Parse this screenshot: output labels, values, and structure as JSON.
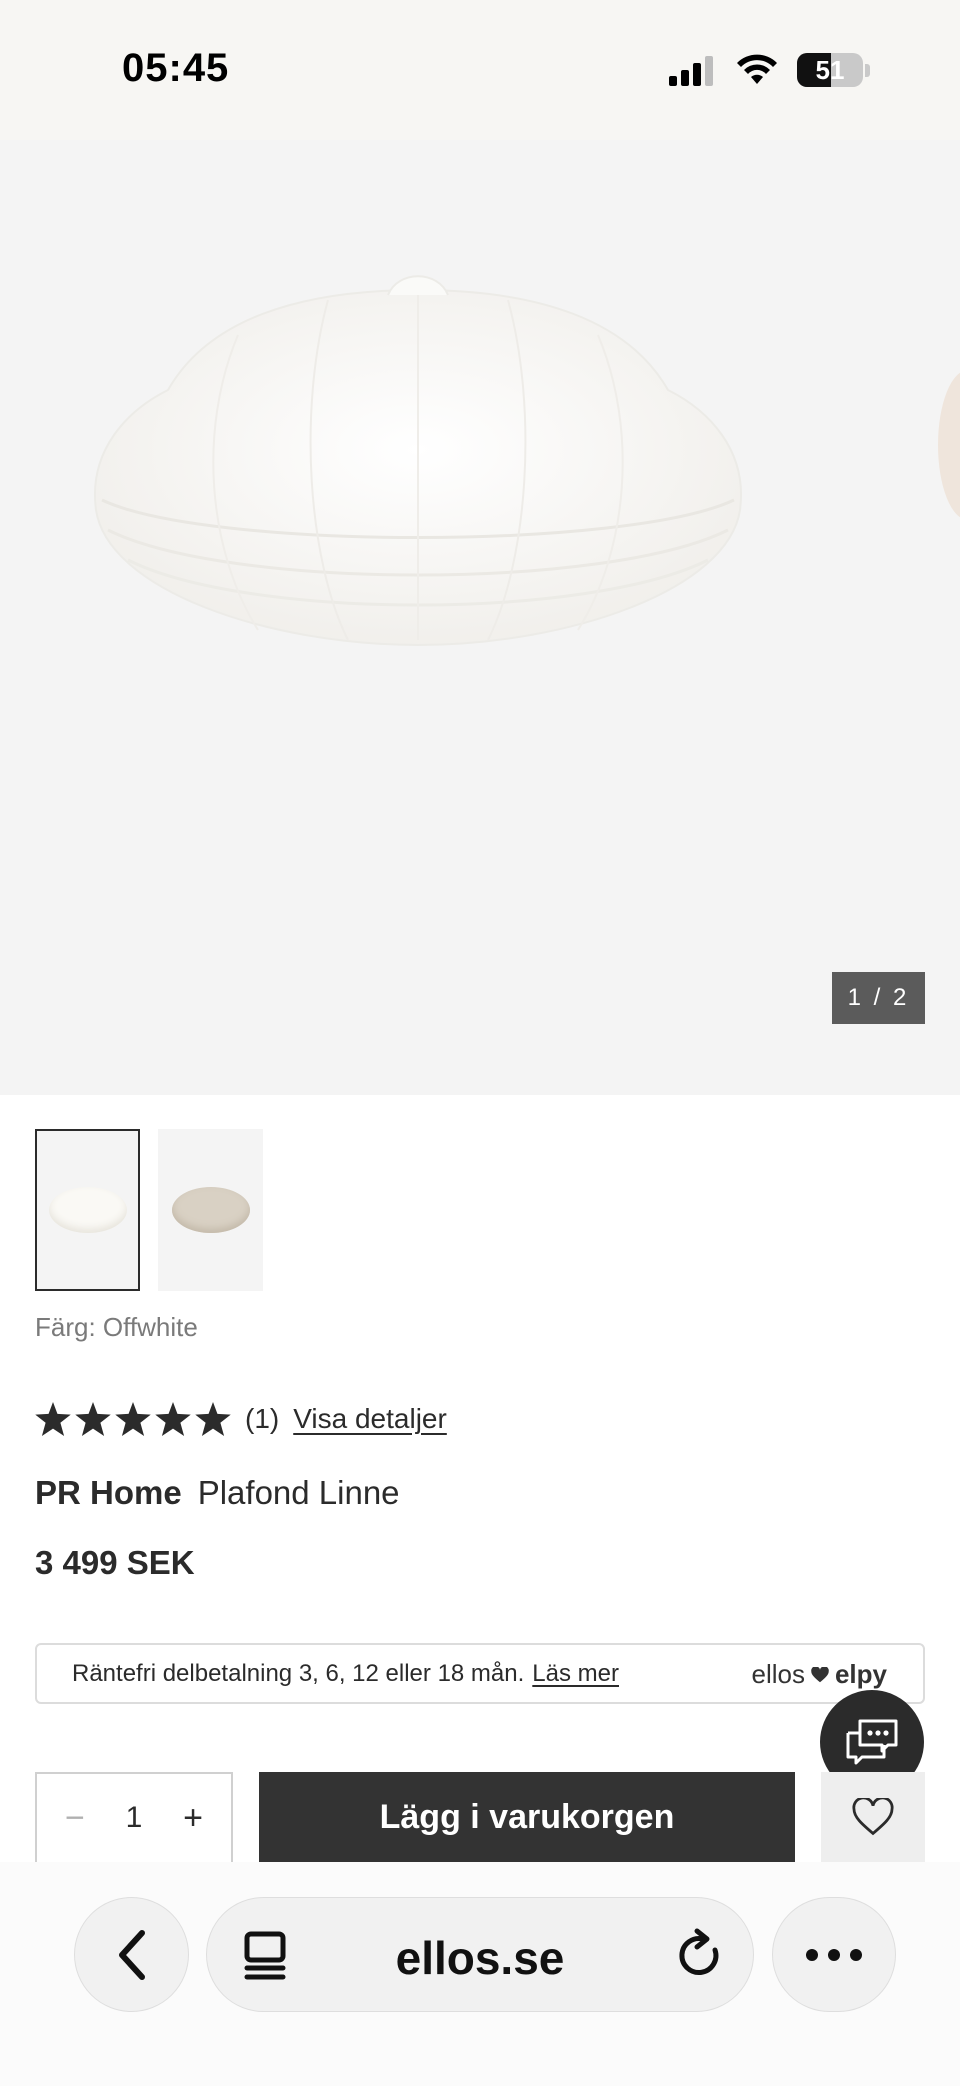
{
  "status_bar": {
    "time": "05:45",
    "battery_level": "51"
  },
  "gallery": {
    "counter": "1 / 2",
    "thumbnails": [
      {
        "color": "#f7f5f0"
      },
      {
        "color": "#d9d1c4"
      }
    ]
  },
  "product": {
    "color_label": "Färg: Offwhite",
    "rating_count": "(1)",
    "rating_link": "Visa detaljer",
    "brand": "PR Home",
    "name": "Plafond Linne",
    "price": "3 499 SEK"
  },
  "financing": {
    "text": "Räntefri delbetalning 3, 6, 12 eller 18 mån.",
    "link": "Läs mer",
    "brand_left": "ellos",
    "brand_right": "elpy"
  },
  "purchase": {
    "quantity": "1",
    "add_to_cart": "Lägg i varukorgen"
  },
  "browser": {
    "url": "ellos.se"
  },
  "colors": {
    "dark": "#333333",
    "image_bg": "#f4f4f4",
    "status_bg": "#f7f6f3"
  }
}
